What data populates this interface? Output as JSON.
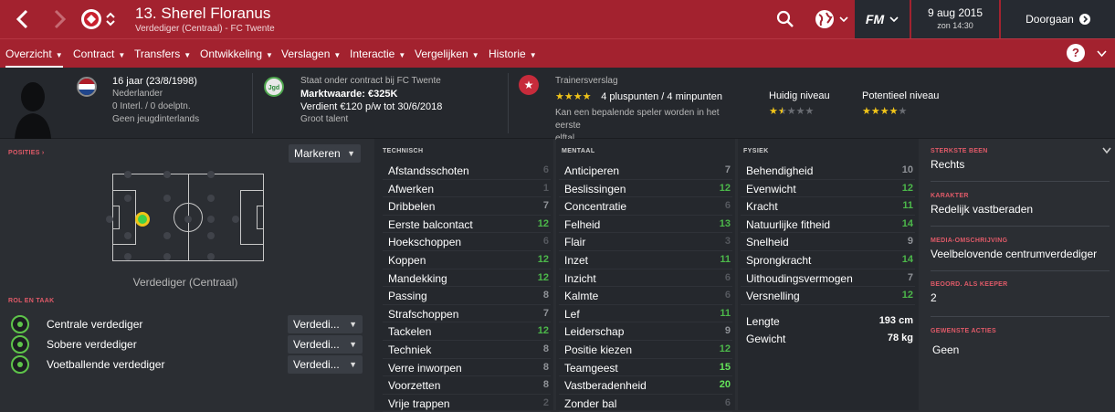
{
  "header": {
    "player_name": "13. Sherel Floranus",
    "player_sub": "Verdediger (Centraal) - FC Twente",
    "game_logo": "FM",
    "date": "9 aug 2015",
    "time": "zon 14:30",
    "continue_label": "Doorgaan"
  },
  "tabs": [
    {
      "label": "Overzicht"
    },
    {
      "label": "Contract"
    },
    {
      "label": "Transfers"
    },
    {
      "label": "Ontwikkeling"
    },
    {
      "label": "Verslagen"
    },
    {
      "label": "Interactie"
    },
    {
      "label": "Vergelijken"
    },
    {
      "label": "Historie"
    }
  ],
  "help_label": "?",
  "info": {
    "age": "16 jaar (23/8/1998)",
    "nationality": "Nederlander",
    "caps": "0 Interl. / 0 doelptn.",
    "youth_caps": "Geen jeugdinterlands",
    "contract_club": "Staat onder contract bij FC Twente",
    "badge_text": "Jgd",
    "market_value": "Marktwaarde: €325K",
    "wage": "Verdient €120 p/w tot 30/6/2018",
    "talent": "Groot talent",
    "trainer_title": "Trainersverslag",
    "trainer_points": "4 pluspunten / 4 minpunten",
    "trainer_text_1": "Kan een bepalende speler worden in het eerste",
    "trainer_text_2": "elftal.",
    "current_level_label": "Huidig niveau",
    "potential_level_label": "Potentieel niveau",
    "trainer_stars": 4,
    "current_stars": 1.5,
    "potential_stars": 4
  },
  "positions": {
    "label": "POSITIES",
    "markeren": "Markeren",
    "position_name": "Verdediger (Centraal)"
  },
  "roles": {
    "label": "ROL EN TAAK",
    "items": [
      {
        "name": "Centrale verdediger",
        "duty": "Verdedi..."
      },
      {
        "name": "Sobere verdediger",
        "duty": "Verdedi..."
      },
      {
        "name": "Voetballende verdediger",
        "duty": "Verdedi..."
      }
    ]
  },
  "technical": {
    "title": "TECHNISCH",
    "rows": [
      {
        "name": "Afstandsschoten",
        "value": "6"
      },
      {
        "name": "Afwerken",
        "value": "1"
      },
      {
        "name": "Dribbelen",
        "value": "7"
      },
      {
        "name": "Eerste balcontact",
        "value": "12"
      },
      {
        "name": "Hoekschoppen",
        "value": "6"
      },
      {
        "name": "Koppen",
        "value": "12"
      },
      {
        "name": "Mandekking",
        "value": "12"
      },
      {
        "name": "Passing",
        "value": "8"
      },
      {
        "name": "Strafschoppen",
        "value": "7"
      },
      {
        "name": "Tackelen",
        "value": "12"
      },
      {
        "name": "Techniek",
        "value": "8"
      },
      {
        "name": "Verre inworpen",
        "value": "8"
      },
      {
        "name": "Voorzetten",
        "value": "8"
      },
      {
        "name": "Vrije trappen",
        "value": "2"
      }
    ]
  },
  "mental": {
    "title": "MENTAAL",
    "rows": [
      {
        "name": "Anticiperen",
        "value": "7"
      },
      {
        "name": "Beslissingen",
        "value": "12"
      },
      {
        "name": "Concentratie",
        "value": "6"
      },
      {
        "name": "Felheid",
        "value": "13"
      },
      {
        "name": "Flair",
        "value": "3"
      },
      {
        "name": "Inzet",
        "value": "11"
      },
      {
        "name": "Inzicht",
        "value": "6"
      },
      {
        "name": "Kalmte",
        "value": "6"
      },
      {
        "name": "Lef",
        "value": "11"
      },
      {
        "name": "Leiderschap",
        "value": "9"
      },
      {
        "name": "Positie kiezen",
        "value": "12"
      },
      {
        "name": "Teamgeest",
        "value": "15"
      },
      {
        "name": "Vastberadenheid",
        "value": "20"
      },
      {
        "name": "Zonder bal",
        "value": "6"
      }
    ]
  },
  "physical": {
    "title": "FYSIEK",
    "rows": [
      {
        "name": "Behendigheid",
        "value": "10"
      },
      {
        "name": "Evenwicht",
        "value": "12"
      },
      {
        "name": "Kracht",
        "value": "11"
      },
      {
        "name": "Natuurlijke fitheid",
        "value": "14"
      },
      {
        "name": "Snelheid",
        "value": "9"
      },
      {
        "name": "Sprongkracht",
        "value": "14"
      },
      {
        "name": "Uithoudingsvermogen",
        "value": "7"
      },
      {
        "name": "Versnelling",
        "value": "12"
      }
    ],
    "length_label": "Lengte",
    "length_value": "193 cm",
    "weight_label": "Gewicht",
    "weight_value": "78 kg"
  },
  "side_info": [
    {
      "label": "STERKSTE BEEN",
      "value": "Rechts"
    },
    {
      "label": "KARAKTER",
      "value": "Redelijk vastberaden"
    },
    {
      "label": "MEDIA-OMSCHRIJVING",
      "value": "Veelbelovende centrumverdediger"
    },
    {
      "label": "BEOORD. ALS KEEPER",
      "value": "2"
    },
    {
      "label": "GEWENSTE ACTIES",
      "value": "Geen"
    }
  ],
  "colors": {
    "accent": "#a3222f",
    "attr_good": "#4cb84a",
    "attr_high": "#64e45a",
    "star": "#f0c419"
  }
}
